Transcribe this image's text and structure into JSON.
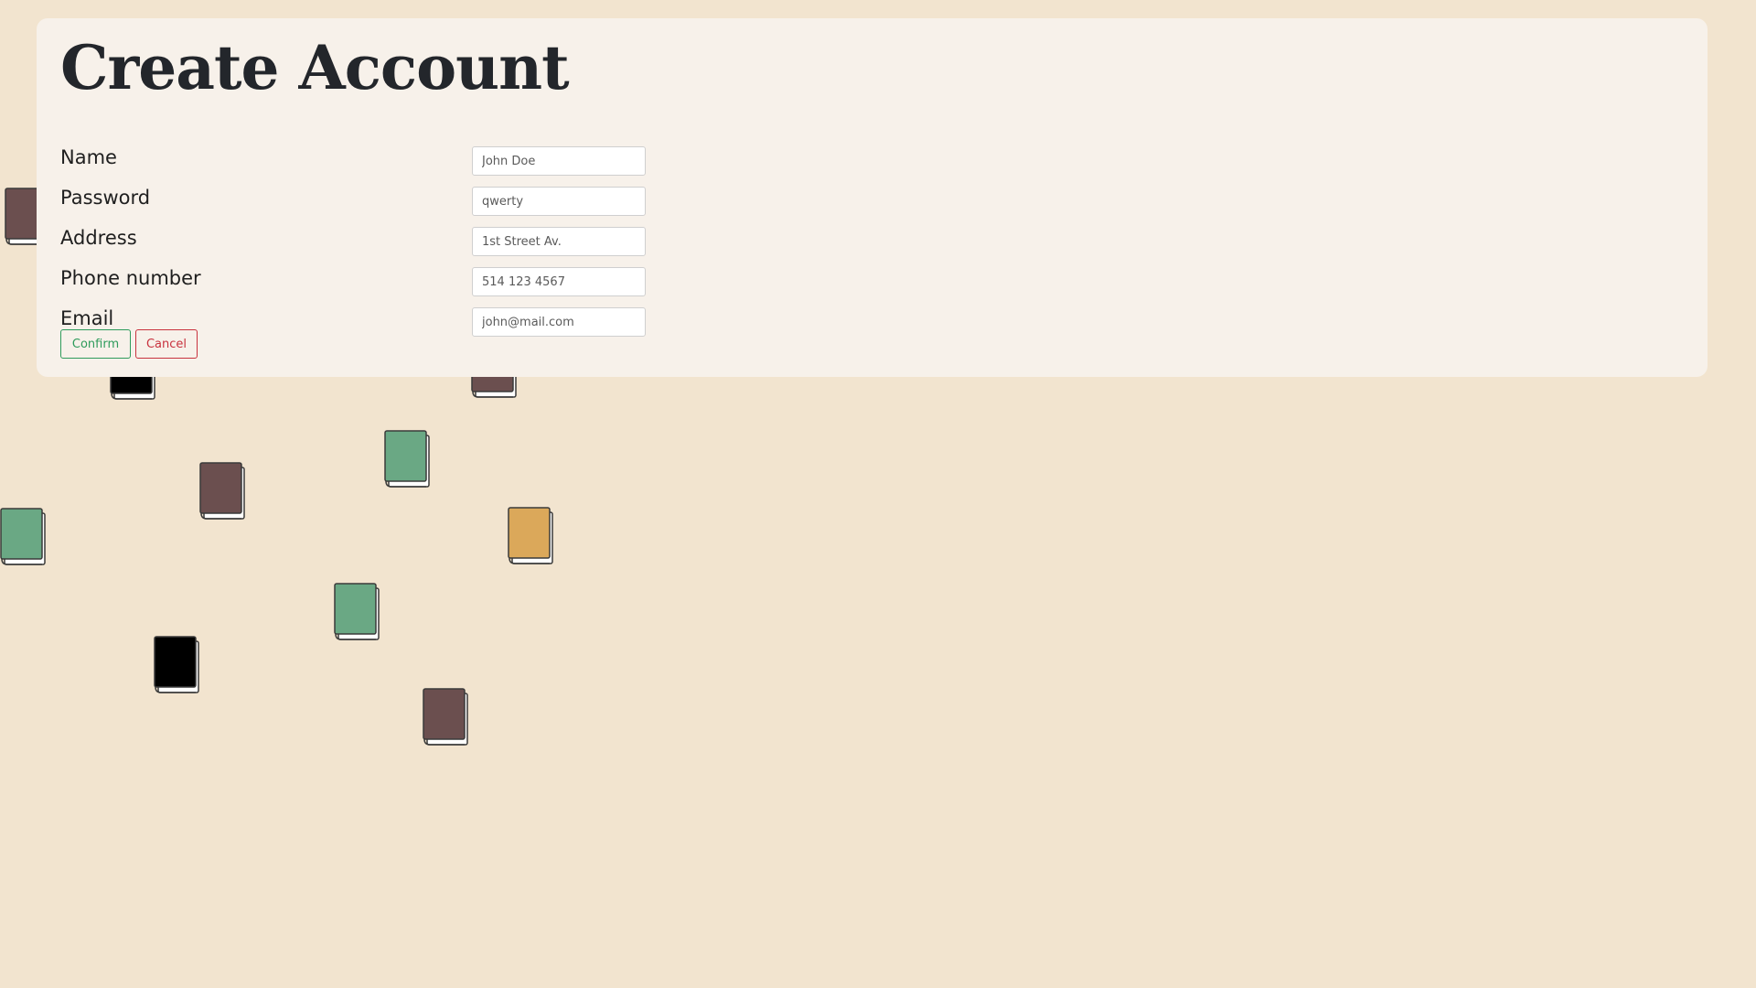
{
  "form": {
    "title": "Create Account",
    "fields": [
      {
        "label": "Name",
        "placeholder": "John Doe"
      },
      {
        "label": "Password",
        "placeholder": "qwerty"
      },
      {
        "label": "Address",
        "placeholder": "1st Street Av."
      },
      {
        "label": "Phone number",
        "placeholder": "514 123 4567"
      },
      {
        "label": "Email",
        "placeholder": "john@mail.com"
      }
    ],
    "confirm_label": "Confirm",
    "cancel_label": "Cancel"
  },
  "colors": {
    "background": "#f2e4cf",
    "panel": "#f7f1ea",
    "confirm": "#2e9b5b",
    "cancel": "#c8323e"
  },
  "background_books": [
    {
      "icon": "book-icon",
      "color": "#6b4f4f"
    },
    {
      "icon": "book-icon",
      "color": "#000000"
    },
    {
      "icon": "book-icon",
      "color": "#6b4f4f"
    },
    {
      "icon": "book-icon",
      "color": "#6aa884"
    },
    {
      "icon": "book-icon",
      "color": "#6b4f4f"
    },
    {
      "icon": "book-icon",
      "color": "#6aa884"
    },
    {
      "icon": "book-icon",
      "color": "#dba85a"
    },
    {
      "icon": "book-icon",
      "color": "#6aa884"
    },
    {
      "icon": "book-icon",
      "color": "#000000"
    },
    {
      "icon": "book-icon",
      "color": "#6b4f4f"
    }
  ]
}
